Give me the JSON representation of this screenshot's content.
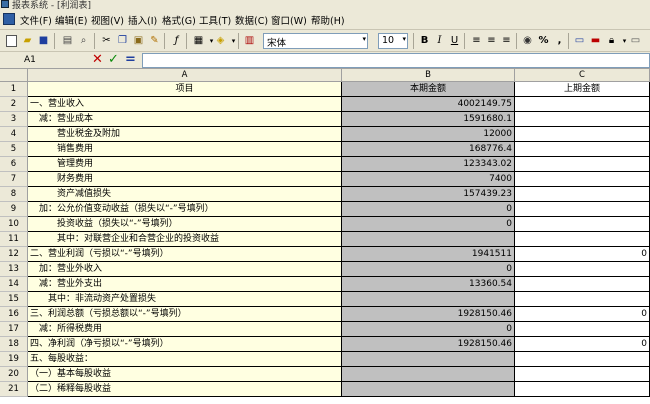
{
  "window": {
    "title": "报表系统 - [利润表]"
  },
  "menu": [
    "文件(F)",
    "编辑(E)",
    "视图(V)",
    "插入(I)",
    "格式(G)",
    "工具(T)",
    "数据(C)",
    "窗口(W)",
    "帮助(H)"
  ],
  "toolbar": {
    "font": "宋体",
    "size": "10",
    "bold": "B",
    "italic": "I",
    "underline": "U",
    "percent": "%",
    "comma": ","
  },
  "formula": {
    "cell_ref": "A1",
    "cancel": "✕",
    "confirm": "✓",
    "equals": "="
  },
  "columns": {
    "A": "A",
    "B": "B",
    "C": "C"
  },
  "header_row": {
    "num": "1",
    "a": "项目",
    "b": "本期金额",
    "c": "上期金额"
  },
  "rows": [
    {
      "num": "2",
      "a": "一、营业收入",
      "b": "4002149.75",
      "c": ""
    },
    {
      "num": "3",
      "a": "　减：营业成本",
      "b": "1591680.1",
      "c": ""
    },
    {
      "num": "4",
      "a": "　　　营业税金及附加",
      "b": "12000",
      "c": ""
    },
    {
      "num": "5",
      "a": "　　　销售费用",
      "b": "168776.4",
      "c": ""
    },
    {
      "num": "6",
      "a": "　　　管理费用",
      "b": "123343.02",
      "c": ""
    },
    {
      "num": "7",
      "a": "　　　财务费用",
      "b": "7400",
      "c": ""
    },
    {
      "num": "8",
      "a": "　　　资产减值损失",
      "b": "157439.23",
      "c": ""
    },
    {
      "num": "9",
      "a": "　加：公允价值变动收益（损失以“-”号填列）",
      "b": "0",
      "c": ""
    },
    {
      "num": "10",
      "a": "　　　投资收益（损失以“-”号填列）",
      "b": "0",
      "c": ""
    },
    {
      "num": "11",
      "a": "　　　其中：对联营企业和合营企业的投资收益",
      "b": "",
      "c": ""
    },
    {
      "num": "12",
      "a": "二、营业利润（亏损以“-”号填列）",
      "b": "1941511",
      "c": "0"
    },
    {
      "num": "13",
      "a": "　加：营业外收入",
      "b": "0",
      "c": ""
    },
    {
      "num": "14",
      "a": "　减：营业外支出",
      "b": "13360.54",
      "c": ""
    },
    {
      "num": "15",
      "a": "　　其中：非流动资产处置损失",
      "b": "",
      "c": ""
    },
    {
      "num": "16",
      "a": "三、利润总额（亏损总额以“-”号填列）",
      "b": "1928150.46",
      "c": "0"
    },
    {
      "num": "17",
      "a": "　减：所得税费用",
      "b": "0",
      "c": ""
    },
    {
      "num": "18",
      "a": "四、净利润（净亏损以“-”号填列）",
      "b": "1928150.46",
      "c": "0"
    },
    {
      "num": "19",
      "a": "五、每股收益：",
      "b": "",
      "c": ""
    },
    {
      "num": "20",
      "a": "（一）基本每股收益",
      "b": "",
      "c": ""
    },
    {
      "num": "21",
      "a": "（二）稀释每股收益",
      "b": "",
      "c": ""
    }
  ]
}
